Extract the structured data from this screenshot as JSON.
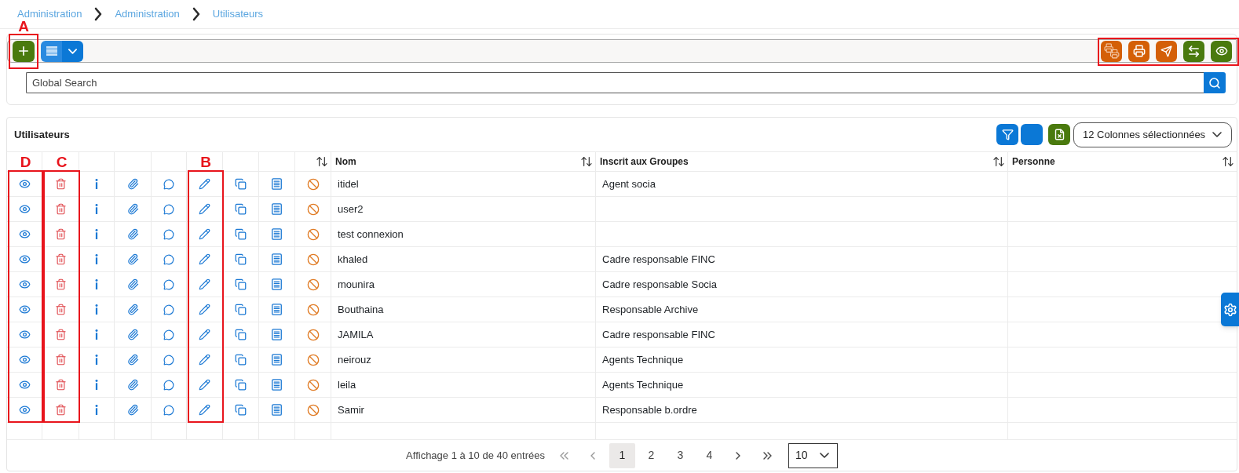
{
  "breadcrumb": [
    {
      "label": "Administration"
    },
    {
      "label": "Administration"
    },
    {
      "label": "Utilisateurs"
    }
  ],
  "toolbar": {
    "add_button": {
      "annotation": "A"
    },
    "action_group": {
      "annotated": true
    }
  },
  "search": {
    "placeholder": "Global Search"
  },
  "table": {
    "title": "Utilisateurs",
    "column_selector": {
      "value": "12 Colonnes sélectionnées"
    },
    "columns": [
      {
        "kind": "action",
        "sortable": false,
        "annotation": "D"
      },
      {
        "kind": "action",
        "sortable": false,
        "annotation": "C"
      },
      {
        "kind": "action",
        "sortable": false
      },
      {
        "kind": "action",
        "sortable": false
      },
      {
        "kind": "action",
        "sortable": false
      },
      {
        "kind": "action",
        "sortable": false,
        "annotation": "B"
      },
      {
        "kind": "action",
        "sortable": false
      },
      {
        "kind": "action",
        "sortable": false
      },
      {
        "kind": "action",
        "sortable": true
      },
      {
        "kind": "text",
        "label": "Nom",
        "sortable": true
      },
      {
        "kind": "text",
        "label": "Inscrit aux Groupes",
        "sortable": true
      },
      {
        "kind": "text",
        "label": "Personne",
        "sortable": true
      }
    ],
    "rows": [
      {
        "nom": "itidel",
        "groupes": "Agent socia"
      },
      {
        "nom": "user2"
      },
      {
        "nom": "test connexion"
      },
      {
        "nom": "khaled",
        "groupes": "Cadre responsable FINC"
      },
      {
        "nom": "mounira",
        "groupes": "Cadre responsable Socia"
      },
      {
        "nom": "Bouthaina",
        "groupes": "Responsable Archive"
      },
      {
        "nom": "JAMILA",
        "groupes": "Cadre responsable FINC"
      },
      {
        "nom": "neirouz",
        "groupes": "Agents Technique"
      },
      {
        "nom": "leila",
        "groupes": "Agents Technique"
      },
      {
        "nom": "Samir",
        "groupes": "Responsable b.ordre"
      }
    ]
  },
  "pagination": {
    "summary": "Affichage 1 à 10 de 40 entrées",
    "pages": [
      {
        "label": "1",
        "selected": true
      },
      {
        "label": "2",
        "selected": false
      },
      {
        "label": "3",
        "selected": false
      },
      {
        "label": "4",
        "selected": false
      }
    ],
    "page_size": "10"
  }
}
